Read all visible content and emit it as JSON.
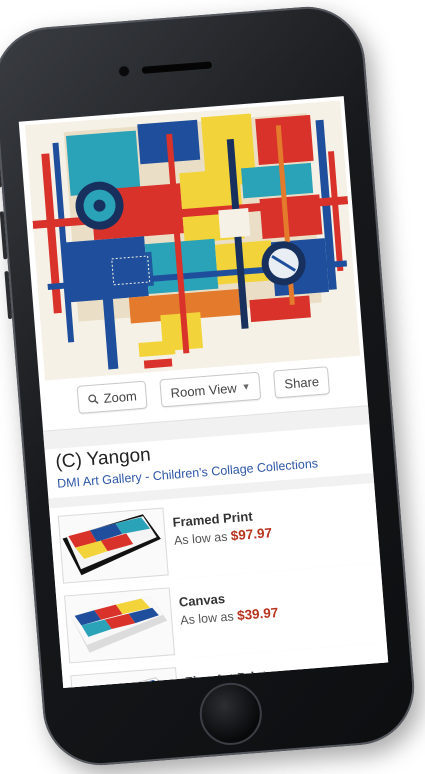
{
  "artwork": {
    "colors": {
      "red": "#d8322a",
      "blue": "#1f4f9c",
      "navy": "#17305e",
      "yellow": "#f2d43a",
      "teal": "#2aa2b8",
      "cream": "#f6f1e6",
      "orange": "#e47a2b"
    }
  },
  "actions": {
    "zoom_label": "Zoom",
    "room_view_label": "Room View",
    "share_label": "Share"
  },
  "product": {
    "title": "(C) Yangon",
    "subtitle": "DMI Art Gallery - Children's Collage Collections"
  },
  "options": [
    {
      "name": "Framed Print",
      "price_prefix": "As low as",
      "price": "$97.97"
    },
    {
      "name": "Canvas",
      "price_prefix": "As low as",
      "price": "$39.97"
    },
    {
      "name": "Fine Art Print",
      "price_prefix": "",
      "price": ""
    }
  ],
  "icons": {
    "zoom": "magnifier-icon",
    "room_view": "chevron-down-icon"
  }
}
